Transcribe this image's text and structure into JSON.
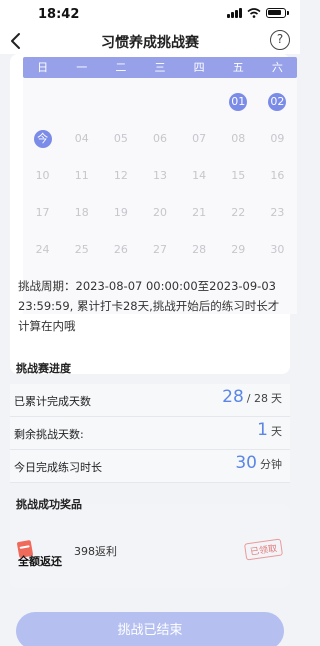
{
  "status": {
    "time": "18:42"
  },
  "header": {
    "title": "习惯养成挑战赛",
    "help": "?"
  },
  "calendar": {
    "weekdays": [
      "日",
      "一",
      "二",
      "三",
      "四",
      "五",
      "六"
    ],
    "rows": [
      [
        "",
        "",
        "",
        "",
        "",
        "01",
        "02"
      ],
      [
        "今",
        "04",
        "05",
        "06",
        "07",
        "08",
        "09"
      ],
      [
        "10",
        "11",
        "12",
        "13",
        "14",
        "15",
        "16"
      ],
      [
        "17",
        "18",
        "19",
        "20",
        "21",
        "22",
        "23"
      ],
      [
        "24",
        "25",
        "26",
        "27",
        "28",
        "29",
        "30"
      ]
    ],
    "marked_days": [
      "01",
      "02",
      "今"
    ],
    "accent_color": "#7b8ce8"
  },
  "period_text": "挑战周期：2023-08-07 00:00:00至2023-09-03 23:59:59, 累计打卡28天,挑战开始后的练习时长才计算在内哦",
  "progress": {
    "title": "挑战赛进度",
    "rows": [
      {
        "label": "已累计完成天数",
        "value": "28",
        "total": "/ 28",
        "unit": "天"
      },
      {
        "label": "剩余挑战天数:",
        "value": "1",
        "total": "",
        "unit": "天"
      },
      {
        "label": "今日完成练习时长",
        "value": "30",
        "total": "",
        "unit": "分钟"
      }
    ]
  },
  "reward": {
    "title": "挑战成功奖品",
    "name": "全额返还",
    "desc": "398返利",
    "stamp": "已领取"
  },
  "footer": {
    "button_label": "挑战已结束"
  }
}
